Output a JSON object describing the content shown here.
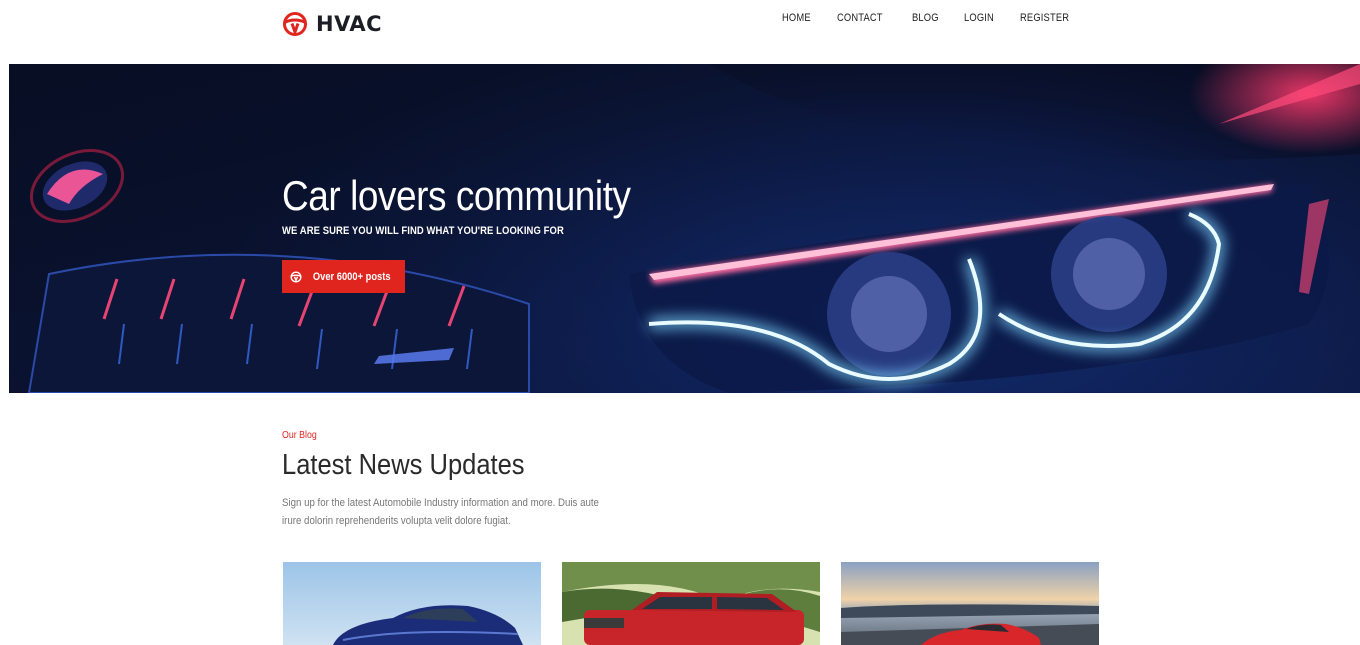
{
  "header": {
    "logo_text": "HVAC",
    "nav": [
      "HOME",
      "CONTACT",
      "BLOG",
      "LOGIN",
      "REGISTER"
    ]
  },
  "hero": {
    "title": "Car lovers community",
    "subtitle": "WE ARE SURE YOU WILL FIND WHAT YOU'RE LOOKING FOR",
    "button_label": "Over 6000+ posts",
    "image": "car-headlight-photo"
  },
  "blog": {
    "eyebrow": "Our Blog",
    "title": "Latest News Updates",
    "description": "Sign up for the latest Automobile Industry information and more. Duis aute irure dolorin reprehenderits volupta velit dolore fugiat.",
    "cards": [
      {
        "image": "blue-sedan-photo"
      },
      {
        "image": "red-suv-photo"
      },
      {
        "image": "red-sports-car-photo"
      }
    ]
  },
  "colors": {
    "accent": "#e0251f",
    "heading": "#2a2a2a",
    "muted": "#777777"
  }
}
